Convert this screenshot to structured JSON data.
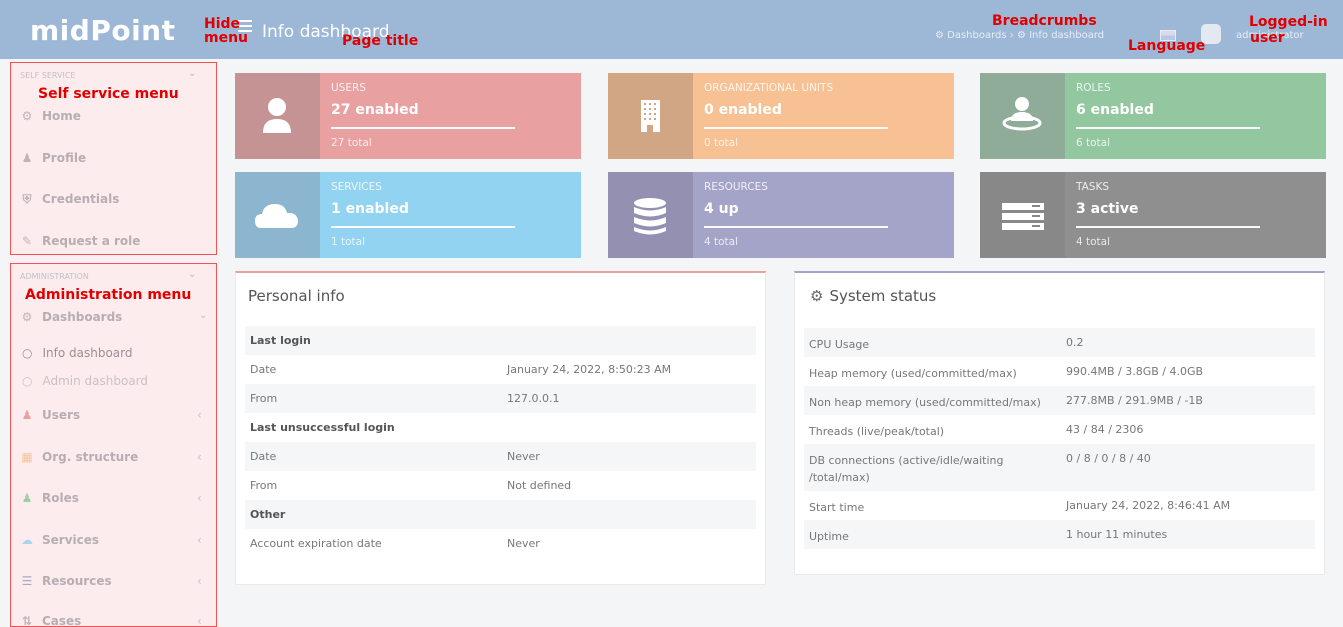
{
  "header": {
    "logo": "midPoint",
    "page_title": "Info dashboard",
    "breadcrumbs": "⚙ Dashboards › ⚙ Info dashboard",
    "user": "administrator"
  },
  "annotations": {
    "hide_menu": "Hide menu",
    "page_title": "Page title",
    "breadcrumbs": "Breadcrumbs",
    "language": "Language",
    "logged_in_user": "Logged-in user",
    "self_service_menu": "Self service menu",
    "administration_menu": "Administration menu"
  },
  "sidebar": {
    "self_service": {
      "title": "SELF SERVICE",
      "items": [
        {
          "icon": "dashboard-icon",
          "label": "Home"
        },
        {
          "icon": "user-icon",
          "label": "Profile"
        },
        {
          "icon": "shield-icon",
          "label": "Credentials"
        },
        {
          "icon": "edit-icon",
          "label": "Request a role"
        }
      ]
    },
    "administration": {
      "title": "ADMINISTRATION",
      "items": [
        {
          "icon": "dashboard-icon",
          "label": "Dashboards"
        },
        {
          "icon": "user-icon",
          "label": "Users"
        },
        {
          "icon": "building-icon",
          "label": "Org. structure"
        },
        {
          "icon": "roles-icon",
          "label": "Roles"
        },
        {
          "icon": "cloud-icon",
          "label": "Services"
        },
        {
          "icon": "database-icon",
          "label": "Resources"
        },
        {
          "icon": "cases-icon",
          "label": "Cases"
        }
      ],
      "subitems": [
        {
          "label": "Info dashboard",
          "color": "#9a8f96"
        },
        {
          "label": "Admin dashboard",
          "color": "#c9c1c7"
        }
      ]
    }
  },
  "stats": [
    {
      "name": "users",
      "icon": "user-icon",
      "label": "USERS",
      "value": "27 enabled",
      "total": "27 total",
      "color": "#e8a0a0",
      "icon_bg": "#c69395"
    },
    {
      "name": "org-units",
      "icon": "building-icon",
      "label": "ORGANIZATIONAL UNITS",
      "value": "0 enabled",
      "total": "0 total",
      "color": "#f7c193",
      "icon_bg": "#d1a685"
    },
    {
      "name": "roles",
      "icon": "roles-icon",
      "label": "ROLES",
      "value": "6 enabled",
      "total": "6 total",
      "color": "#92c7a0",
      "icon_bg": "#8eac98"
    },
    {
      "name": "services",
      "icon": "cloud-icon",
      "label": "SERVICES",
      "value": "1 enabled",
      "total": "1 total",
      "color": "#91d3f0",
      "icon_bg": "#8cb6cf"
    },
    {
      "name": "resources",
      "icon": "database-icon",
      "label": "RESOURCES",
      "value": "4 up",
      "total": "4 total",
      "color": "#a4a3c8",
      "icon_bg": "#9490b2"
    },
    {
      "name": "tasks",
      "icon": "tasks-icon",
      "label": "TASKS",
      "value": "3 active",
      "total": "4 total",
      "color": "#8f8f8f",
      "icon_bg": "#888888"
    }
  ],
  "personal_info": {
    "title": "Personal info",
    "rows": [
      {
        "label": "Last login",
        "value": "",
        "bold": true
      },
      {
        "label": "Date",
        "value": "January 24, 2022, 8:50:23 AM"
      },
      {
        "label": "From",
        "value": "127.0.0.1"
      },
      {
        "label": "Last unsuccessful login",
        "value": "",
        "bold": true
      },
      {
        "label": "Date",
        "value": "Never"
      },
      {
        "label": "From",
        "value": "Not defined"
      },
      {
        "label": "Other",
        "value": "",
        "bold": true
      },
      {
        "label": "Account expiration date",
        "value": "Never"
      }
    ]
  },
  "system_status": {
    "title": "System status",
    "rows": [
      {
        "label": "CPU Usage",
        "value": "0.2"
      },
      {
        "label": "Heap memory (used/committed/max)",
        "value": "990.4MB / 3.8GB / 4.0GB"
      },
      {
        "label": "Non heap memory (used/committed/max)",
        "value": "277.8MB / 291.9MB / -1B"
      },
      {
        "label": "Threads (live/peak/total)",
        "value": "43 / 84 / 2306"
      },
      {
        "label": "DB connections (active/idle/waiting /total/max)",
        "value": "0 / 8 / 0 / 8 / 40"
      },
      {
        "label": "Start time",
        "value": "January 24, 2022, 8:46:41 AM"
      },
      {
        "label": "Uptime",
        "value": "1 hour 11 minutes"
      }
    ]
  }
}
